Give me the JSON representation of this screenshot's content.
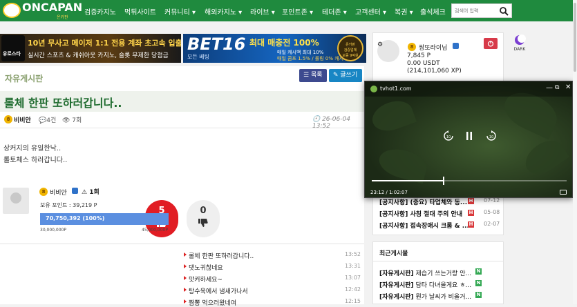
{
  "logo": {
    "text": "ONCAPAN",
    "sub": "온카판"
  },
  "nav": [
    "검증카지노",
    "먹튀사이트",
    "커뮤니티 ▾",
    "해외카지노 ▾",
    "라이브 ▾",
    "포인트존 ▾",
    "테더존 ▾",
    "고객센터 ▾",
    "복권 ▾",
    "출석체크"
  ],
  "search": {
    "placeholder": "검색어 입력"
  },
  "banners": {
    "left": {
      "brand": "유로스타",
      "line1": "10년 무사고 메이저 1:1 전용 계좌 초고속 입출금",
      "line2": "실시간 스포츠 & 캐쉬아웃 카지노, 슬롯 무제한 당첨금"
    },
    "right": {
      "brand": "BET16",
      "sub": "모든 베팅",
      "line1": "최대 매충전 100%",
      "line2": "매일 캐시백 최대 10%",
      "line3": "매일 콤프 1.5% / 롤링 0% 캐시지급",
      "badge_top": "온카판",
      "badge_mid": "검증업체",
      "badge_bottom": "보증 9억원"
    }
  },
  "board": {
    "title": "자유게시판",
    "list_label": "목록",
    "write_label": "글쓰기",
    "post_title": "롤체 한판 또하러갑니다..",
    "author": "비비안",
    "author_level": "8",
    "comments": "4건",
    "views": "7회",
    "date": "26-06-04 13:52",
    "body": [
      "상커지의 유일한낙..",
      "롤토체스 하러갑니다.."
    ],
    "upvotes": "5",
    "downvotes": "0"
  },
  "author_card": {
    "name": "비비안",
    "warn": "1회",
    "points": "보유 포인트 : 39,219 P",
    "progress_label": "70,750,392 (100%)",
    "progress": 1.0,
    "min": "30,000,000P",
    "max": "45,000,000P"
  },
  "recent_posts": [
    {
      "title": "롤체 한판 또하러갑니다..",
      "time": "13:52"
    },
    {
      "title": "댓노귀찮네요",
      "time": "13:31"
    },
    {
      "title": "맛커하세요~",
      "time": "13:07"
    },
    {
      "title": "탕수육에서 냄새가나서",
      "time": "12:42"
    },
    {
      "title": "짬뽕 먹으러왔네여",
      "time": "12:15"
    }
  ],
  "sidebar": {
    "name": "쌍또라이님",
    "level": "8",
    "points": "7,845 P",
    "usdt": "0.00 USDT",
    "xp": "(214,101,060 XP)",
    "dark_label": "DARK"
  },
  "notices": [
    {
      "text": "[공지사항] (중요) 타업체와 동...",
      "date": "07-12"
    },
    {
      "text": "[공지사항] 사칭 절대 주의 안내",
      "date": "05-08"
    },
    {
      "text": "[공지사항] 접속장애시 크롬 & ...",
      "date": "02-07"
    }
  ],
  "recent_comments": {
    "title": "최근게시물",
    "items": [
      {
        "cat": "[자유게시판]",
        "text": "제습기 쓰는거랑 안..."
      },
      {
        "cat": "[자유게시판]",
        "text": "담타 다녀올게요 ㅎ..."
      },
      {
        "cat": "[자유게시판]",
        "text": "뭔가 날씨가 비올거..."
      }
    ]
  },
  "video": {
    "url": "tvhot1.com",
    "time": "23:12 / 1:02:07",
    "progress": 0.37
  }
}
